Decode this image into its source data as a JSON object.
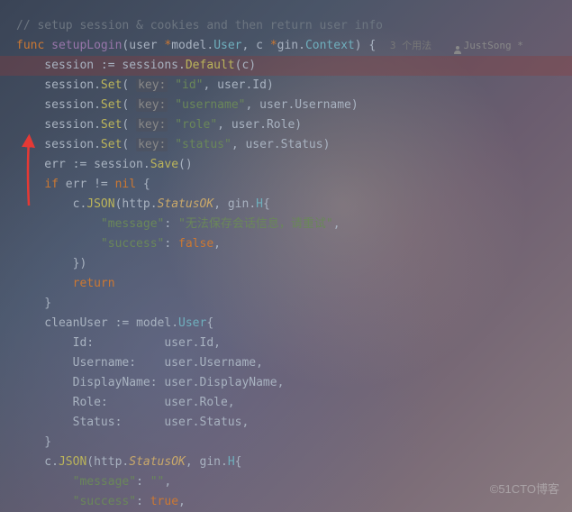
{
  "comment": "// setup session & cookies and then return user info",
  "func_kw": "func",
  "func_name": "setupLogin",
  "params": {
    "user": "user",
    "star1": "*",
    "model": "model",
    "user_type": "User",
    "c_param": "c",
    "star2": "*",
    "gin": "gin",
    "context": "Context"
  },
  "usage": "3 个用法",
  "author": "JustSong *",
  "lines": {
    "session_decl_left": "    session := sessions.",
    "default_call": "Default",
    "c_arg": "(c)",
    "set_prefix": "    session.",
    "set_method": "Set",
    "key_hint": "key:",
    "id_str": "\"id\"",
    "username_str": "\"username\"",
    "role_str": "\"role\"",
    "status_str": "\"status\"",
    "user_id": "user.Id",
    "user_username": "user.Username",
    "user_role": "user.Role",
    "user_status": "user.Status",
    "err_decl": "    err := session.",
    "save": "Save",
    "empty_call": "()",
    "if_kw": "if",
    "err_check": " err != ",
    "nil": "nil",
    "brace_open": " {",
    "c_json_indent": "        c.",
    "json_method": "JSON",
    "http": "http",
    "status_ok": "StatusOK",
    "gin_h": "gin.",
    "h_type": "H",
    "msg_key": "\"message\"",
    "msg_val": "\"无法保存会话信息，请重试\"",
    "success_key": "\"success\"",
    "false_val": "false",
    "true_val": "true",
    "brace_close_paren": "        })",
    "return_kw": "return",
    "brace_close": "    }",
    "cleanuser_left": "    cleanUser := ",
    "model_type": "model",
    "user_struct": "User",
    "field_id": "        Id:          user.Id,",
    "field_username": "        Username:    user.Username,",
    "field_display": "        DisplayName: user.DisplayName,",
    "field_role": "        Role:        user.Role,",
    "field_status": "        Status:      user.Status,",
    "c_json2": "    c.",
    "empty_str": "\"\"",
    "comma": ",",
    "colon": ":"
  },
  "watermark": "©51CTO博客"
}
